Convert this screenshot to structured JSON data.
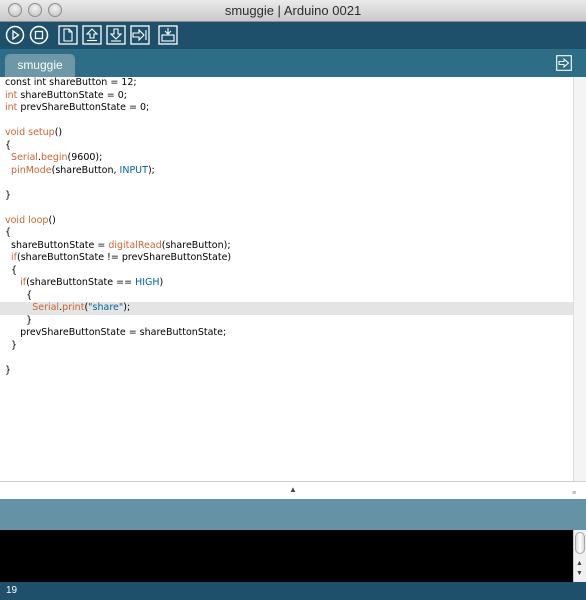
{
  "window": {
    "title": "smuggie | Arduino 0021"
  },
  "toolbar": {
    "buttons": [
      {
        "icon": "verify-icon"
      },
      {
        "icon": "stop-icon"
      },
      {
        "icon": "new-icon"
      },
      {
        "icon": "open-icon"
      },
      {
        "icon": "save-icon"
      },
      {
        "icon": "upload-icon"
      },
      {
        "icon": "serial-monitor-icon"
      }
    ]
  },
  "tabs": {
    "active": "smuggie",
    "tab_menu_icon": "tab-menu-icon"
  },
  "editor": {
    "current_line_index": 18,
    "lines": [
      [
        {
          "t": "const int shareButton = 12;"
        }
      ],
      [
        {
          "t": "int",
          "c": "kw"
        },
        {
          "t": " shareButtonState = 0;"
        }
      ],
      [
        {
          "t": "int",
          "c": "kw"
        },
        {
          "t": " prevShareButtonState = 0;"
        }
      ],
      [
        {
          "t": ""
        }
      ],
      [
        {
          "t": "void",
          "c": "kw"
        },
        {
          "t": " "
        },
        {
          "t": "setup",
          "c": "fn"
        },
        {
          "t": "()"
        }
      ],
      [
        {
          "t": "{"
        }
      ],
      [
        {
          "t": "  "
        },
        {
          "t": "Serial",
          "c": "fn"
        },
        {
          "t": "."
        },
        {
          "t": "begin",
          "c": "fn"
        },
        {
          "t": "(9600);"
        }
      ],
      [
        {
          "t": "  "
        },
        {
          "t": "pinMode",
          "c": "fn"
        },
        {
          "t": "(shareButton, "
        },
        {
          "t": "INPUT",
          "c": "ct"
        },
        {
          "t": ");"
        }
      ],
      [
        {
          "t": ""
        }
      ],
      [
        {
          "t": "}"
        }
      ],
      [
        {
          "t": ""
        }
      ],
      [
        {
          "t": "void",
          "c": "kw"
        },
        {
          "t": " "
        },
        {
          "t": "loop",
          "c": "fn"
        },
        {
          "t": "()"
        }
      ],
      [
        {
          "t": "{"
        }
      ],
      [
        {
          "t": "  shareButtonState = "
        },
        {
          "t": "digitalRead",
          "c": "fn"
        },
        {
          "t": "(shareButton);"
        }
      ],
      [
        {
          "t": "  "
        },
        {
          "t": "if",
          "c": "kw"
        },
        {
          "t": "(shareButtonState != prevShareButtonState)"
        }
      ],
      [
        {
          "t": "  {"
        }
      ],
      [
        {
          "t": "     "
        },
        {
          "t": "if",
          "c": "kw"
        },
        {
          "t": "(shareButtonState == "
        },
        {
          "t": "HIGH",
          "c": "ct"
        },
        {
          "t": ")"
        }
      ],
      [
        {
          "t": "       {"
        }
      ],
      [
        {
          "t": "         "
        },
        {
          "t": "Serial",
          "c": "fn"
        },
        {
          "t": "."
        },
        {
          "t": "print",
          "c": "fn"
        },
        {
          "t": "("
        },
        {
          "t": "\"share\"",
          "c": "st"
        },
        {
          "t": ");"
        }
      ],
      [
        {
          "t": "       }"
        }
      ],
      [
        {
          "t": "     prevShareButtonState = shareButtonState;"
        }
      ],
      [
        {
          "t": "  }"
        }
      ],
      [
        {
          "t": ""
        }
      ],
      [
        {
          "t": "}"
        }
      ]
    ]
  },
  "status": {
    "line_number": "19"
  },
  "colors": {
    "toolbar_bg": "#1e4f6b",
    "tabstrip_bg": "#2e6d86",
    "status_bg": "#6592a4",
    "keyword": "#cc6633",
    "constant": "#006699"
  }
}
